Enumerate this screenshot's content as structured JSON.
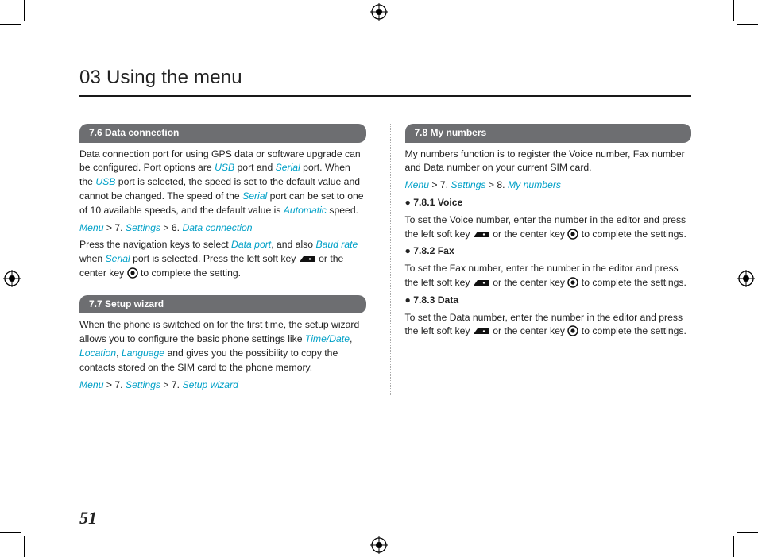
{
  "chapter_title": "03 Using the menu",
  "page_number": "51",
  "left": {
    "s76": {
      "heading": "7.6  Data connection",
      "p1_a": "Data connection port for using GPS data or software upgrade can be configured. Port options are ",
      "usb": "USB",
      "p1_b": " port and ",
      "serial": "Serial",
      "p1_c": " port. When the ",
      "p1_d": " port is selected, the speed is set to the default value and cannot be changed. The speed of the ",
      "p1_e": " port can be set to one of 10 available speeds, and the default value is ",
      "automatic": "Automatic",
      "p1_f": " speed.",
      "nav_menu": "Menu",
      "nav_gt1": " > 7. ",
      "nav_settings": "Settings",
      "nav_gt2": " > 6. ",
      "nav_dc": "Data connection",
      "p2_a": "Press the navigation keys to select ",
      "data_port": "Data port",
      "p2_b": ", and also ",
      "baud_rate": "Baud rate",
      "p2_c": " when ",
      "p2_d": " port is selected. Press the left soft key ",
      "p2_e": " or the center key ",
      "p2_f": " to complete the setting."
    },
    "s77": {
      "heading": "7.7  Setup wizard",
      "p1_a": "When the phone is switched on for the first time, the setup wizard allows you to configure the basic phone settings like ",
      "timedate": "Time/Date",
      "comma1": ", ",
      "location": "Location",
      "comma2": ", ",
      "language": "Language",
      "p1_b": " and gives you the possibility to copy the contacts stored on the SIM card to the phone memory.",
      "nav_menu": "Menu",
      "nav_gt1": " > 7. ",
      "nav_settings": "Settings",
      "nav_gt2": " > 7. ",
      "nav_sw": "Setup wizard"
    }
  },
  "right": {
    "s78": {
      "heading": "7.8  My numbers",
      "p1": "My numbers function is to register the Voice number, Fax number and Data number on your current SIM card.",
      "nav_menu": "Menu",
      "nav_gt1": " > 7. ",
      "nav_settings": "Settings",
      "nav_gt2": " > 8. ",
      "nav_mn": "My numbers",
      "sub1": "7.8.1  Voice",
      "sub1_a": "To set the Voice number, enter the number in the editor and press the left soft key ",
      "sub1_b": " or the center key ",
      "sub1_c": " to complete the settings.",
      "sub2": "7.8.2  Fax",
      "sub2_a": "To set the Fax number, enter the number in the editor and press the left soft key ",
      "sub2_b": " or the center key ",
      "sub2_c": " to complete the settings.",
      "sub3": "7.8.3  Data",
      "sub3_a": "To set the Data number, enter the number in the editor and press the left soft key ",
      "sub3_b": " or the center key ",
      "sub3_c": " to complete the settings."
    }
  }
}
